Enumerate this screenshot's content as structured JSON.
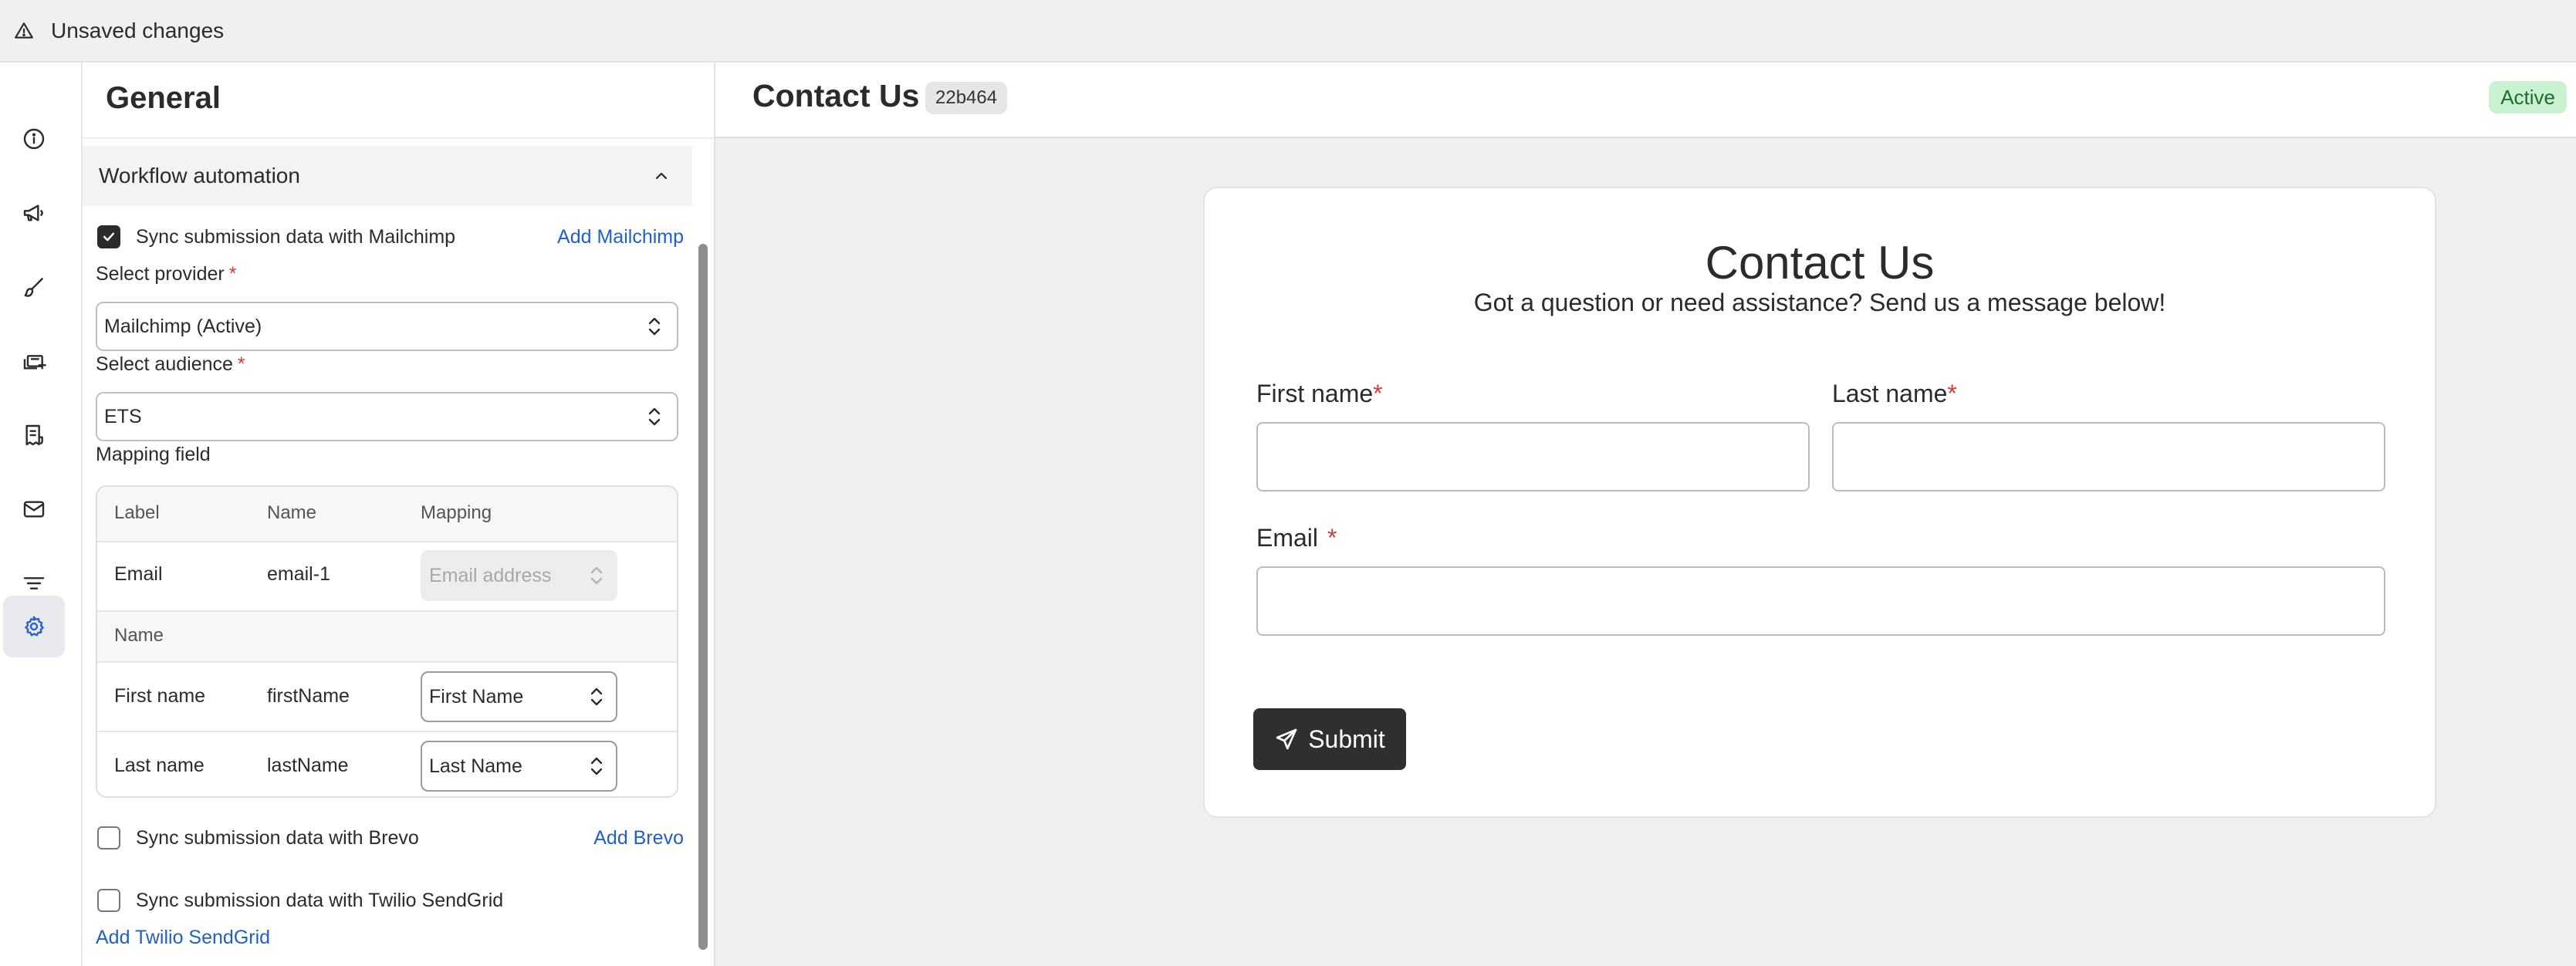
{
  "banner": {
    "text": "Unsaved changes",
    "icon": "warning-icon"
  },
  "rail": {
    "items": [
      {
        "name": "info-icon"
      },
      {
        "name": "megaphone-icon"
      },
      {
        "name": "brush-icon"
      },
      {
        "name": "add-fields-icon"
      },
      {
        "name": "receipt-icon"
      },
      {
        "name": "mail-icon"
      },
      {
        "name": "filter-icon"
      },
      {
        "name": "gear-icon",
        "active": true
      }
    ]
  },
  "panel": {
    "title": "General",
    "section": {
      "label": "Workflow automation",
      "expanded": true
    },
    "mailchimp": {
      "checkbox_label": "Sync submission data with Mailchimp",
      "checked": true,
      "add_link": "Add Mailchimp"
    },
    "provider": {
      "label": "Select provider",
      "required": "*",
      "value": "Mailchimp (Active)"
    },
    "audience": {
      "label": "Select audience",
      "required": "*",
      "value": "ETS"
    },
    "mapping": {
      "label": "Mapping field",
      "columns": [
        "Label",
        "Name",
        "Mapping"
      ],
      "email_row": {
        "label": "Email",
        "name": "email-1",
        "mapping": "Email address",
        "disabled": true
      },
      "group_label": "Name",
      "rows": [
        {
          "label": "First name",
          "name": "firstName",
          "mapping": "First Name"
        },
        {
          "label": "Last name",
          "name": "lastName",
          "mapping": "Last Name"
        }
      ]
    },
    "brevo": {
      "checkbox_label": "Sync submission data with Brevo",
      "checked": false,
      "add_link": "Add Brevo"
    },
    "sendgrid": {
      "checkbox_label": "Sync submission data with Twilio SendGrid",
      "checked": false,
      "add_link": "Add Twilio SendGrid"
    }
  },
  "topbar": {
    "title": "Contact Us",
    "form_id": "22b464",
    "status": "Active"
  },
  "form": {
    "title": "Contact Us",
    "subtitle": "Got a question or need assistance? Send us a message below!",
    "first_name_label": "First name",
    "last_name_label": "Last name",
    "email_label": "Email",
    "required_mark": "*",
    "submit_label": "Submit"
  },
  "colors": {
    "accent_link": "#2060c8",
    "required": "#d23b3b",
    "status_bg": "#c9f2d3",
    "button_bg": "#2f2f2f"
  }
}
